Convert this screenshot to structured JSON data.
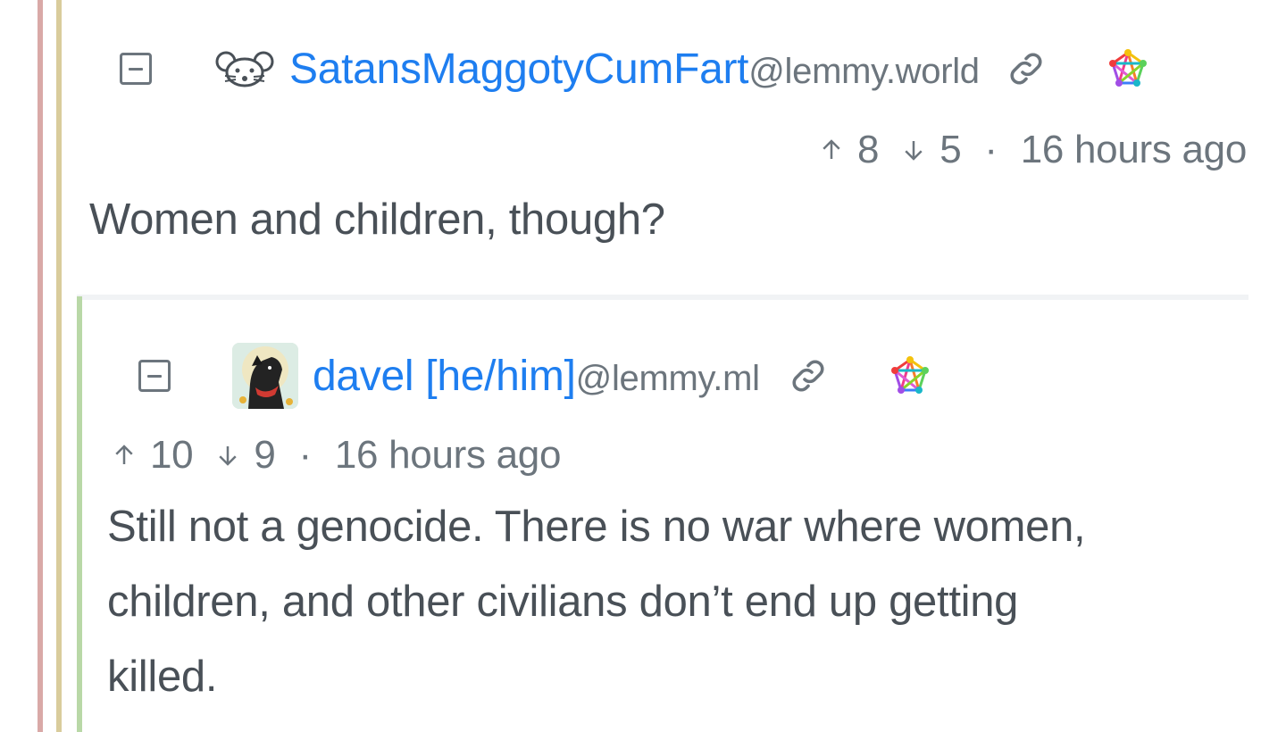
{
  "comments": [
    {
      "username": "SatansMaggotyCumFart",
      "instance": "@lemmy.world",
      "upvotes": "8",
      "downvotes": "5",
      "separator": "·",
      "time": "16 hours ago",
      "body": "Women and children, though?"
    },
    {
      "username": "davel [he/him]",
      "instance": "@lemmy.ml",
      "upvotes": "10",
      "downvotes": "9",
      "separator": "·",
      "time": "16 hours ago",
      "body_lines": [
        "Still not a genocide. There is no war where women,",
        "children, and other civilians don’t end up getting",
        "killed."
      ]
    }
  ],
  "colors": {
    "link": "#1e7ef0",
    "muted": "#6c757d",
    "text": "#495057",
    "thread_line_1": "#d9a9a7",
    "thread_line_2": "#d9cc9c",
    "thread_line_3": "#b9d8a7"
  },
  "icons": {
    "collapse": "minus-square-icon",
    "user_badge": "mouse-face-icon",
    "link": "link-icon",
    "fediverse": "fediverse-pentagram-icon",
    "upvote": "arrow-up-icon",
    "downvote": "arrow-down-icon"
  }
}
